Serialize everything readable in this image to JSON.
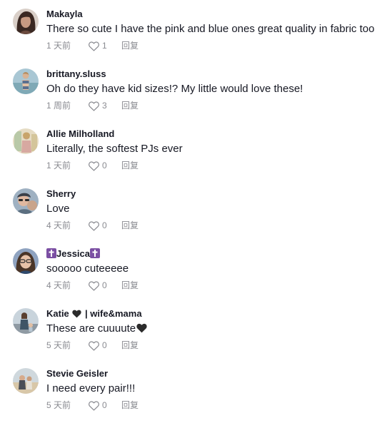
{
  "comments": [
    {
      "username": "Makayla",
      "text": "There so cute I have the pink and blue ones great quality in fabric too",
      "time": "1 天前",
      "likes": "1",
      "reply_label": "回复",
      "avatar_icon": "user-avatar"
    },
    {
      "username": "brittany.sluss",
      "text": "Oh do they have kid sizes!? My little would love these!",
      "time": "1 周前",
      "likes": "3",
      "reply_label": "回复",
      "avatar_icon": "user-avatar"
    },
    {
      "username": "Allie Milholland",
      "text": "Literally, the softest PJs ever",
      "time": "1 天前",
      "likes": "0",
      "reply_label": "回复",
      "avatar_icon": "user-avatar"
    },
    {
      "username": "Sherry",
      "text": "Love",
      "time": "4 天前",
      "likes": "0",
      "reply_label": "回复",
      "avatar_icon": "user-avatar"
    },
    {
      "username": "Jessica",
      "username_decoration": "latin-cross-emoji",
      "text": "sooooo cuteeeee",
      "time": "4 天前",
      "likes": "0",
      "reply_label": "回复",
      "avatar_icon": "user-avatar"
    },
    {
      "username_prefix": "Katie",
      "username_suffix": "| wife&mama",
      "username_decoration": "black-heart-emoji",
      "text": "These are cuuuute",
      "text_decoration": "black-heart-emoji",
      "time": "5 天前",
      "likes": "0",
      "reply_label": "回复",
      "avatar_icon": "user-avatar"
    },
    {
      "username": "Stevie Geisler",
      "text": "I need every pair!!!",
      "time": "5 天前",
      "likes": "0",
      "reply_label": "回复",
      "avatar_icon": "user-avatar"
    }
  ],
  "colors": {
    "text": "#161823",
    "meta": "#8a8b91",
    "cross_emoji": "#7b4fa3",
    "heart": "#2b2b2b"
  }
}
